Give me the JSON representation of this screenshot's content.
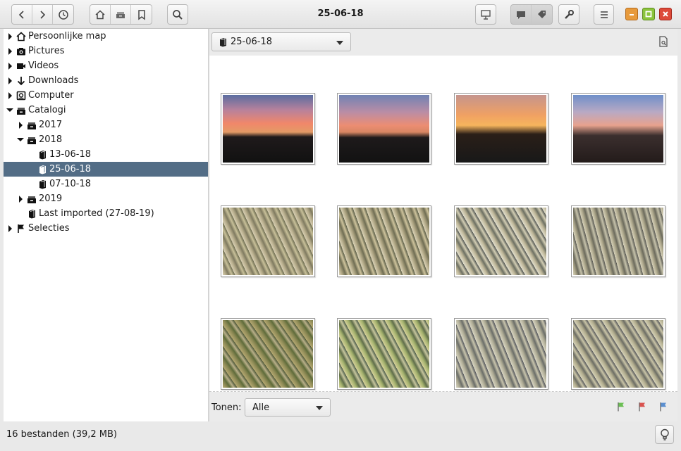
{
  "window": {
    "title": "25-06-18"
  },
  "toolbar": {
    "nav_buttons": [
      "back-icon",
      "forward-icon",
      "history-icon"
    ],
    "location_buttons": [
      "home-icon",
      "catalogs-icon",
      "bookmarks-icon"
    ],
    "search": "search-icon",
    "right_buttons": [
      "presentation-icon",
      "comment-icon",
      "tag-icon",
      "tools-icon",
      "menu-icon"
    ],
    "window_controls": {
      "minimize_color": "#e79a3c",
      "maximize_color": "#8cc43d",
      "close_color": "#dd4a3a"
    }
  },
  "sidebar": {
    "items": [
      {
        "label": "Persoonlijke map",
        "icon": "home-icon",
        "depth": 0,
        "expander": "collapsed"
      },
      {
        "label": "Pictures",
        "icon": "camera-icon",
        "depth": 0,
        "expander": "collapsed"
      },
      {
        "label": "Videos",
        "icon": "video-icon",
        "depth": 0,
        "expander": "collapsed"
      },
      {
        "label": "Downloads",
        "icon": "download-icon",
        "depth": 0,
        "expander": "collapsed"
      },
      {
        "label": "Computer",
        "icon": "harddisk-icon",
        "depth": 0,
        "expander": "collapsed"
      },
      {
        "label": "Catalogi",
        "icon": "catalog-library-icon",
        "depth": 0,
        "expander": "expanded"
      },
      {
        "label": "2017",
        "icon": "catalog-library-icon",
        "depth": 1,
        "expander": "collapsed"
      },
      {
        "label": "2018",
        "icon": "catalog-library-icon",
        "depth": 1,
        "expander": "expanded"
      },
      {
        "label": "13-06-18",
        "icon": "catalog-icon",
        "depth": 2,
        "expander": "none"
      },
      {
        "label": "25-06-18",
        "icon": "catalog-icon",
        "depth": 2,
        "expander": "none",
        "selected": true
      },
      {
        "label": "07-10-18",
        "icon": "catalog-icon",
        "depth": 2,
        "expander": "none"
      },
      {
        "label": "2019",
        "icon": "catalog-library-icon",
        "depth": 1,
        "expander": "collapsed"
      },
      {
        "label": "Last imported (27-08-19)",
        "icon": "catalog-icon",
        "depth": 1,
        "expander": "none"
      },
      {
        "label": "Selecties",
        "icon": "flag-icon",
        "depth": 0,
        "expander": "collapsed"
      }
    ],
    "selected_color": "#536d86"
  },
  "location": {
    "current": "25-06-18"
  },
  "thumbnails": [
    {
      "name": "sunset-1",
      "style": "sunset1"
    },
    {
      "name": "sunset-2",
      "style": "sunset2"
    },
    {
      "name": "sunset-3",
      "style": "sunset3"
    },
    {
      "name": "sunset-4",
      "style": "sunset4"
    },
    {
      "name": "bush-1",
      "style": "bush1"
    },
    {
      "name": "bush-2",
      "style": "bush2"
    },
    {
      "name": "bush-3",
      "style": "bush3"
    },
    {
      "name": "bush-4",
      "style": "bush4"
    },
    {
      "name": "bush-5",
      "style": "bush5"
    },
    {
      "name": "bush-6",
      "style": "bush6"
    },
    {
      "name": "bush-7",
      "style": "bush7"
    },
    {
      "name": "bush-8",
      "style": "bush8"
    }
  ],
  "filter": {
    "label": "Tonen:",
    "value": "Alle",
    "flags": [
      {
        "name": "flag-green-icon",
        "color": "#6cbf55"
      },
      {
        "name": "flag-red-icon",
        "color": "#d9534f"
      },
      {
        "name": "flag-blue-icon",
        "color": "#5b8fd0"
      }
    ]
  },
  "status": {
    "text": "16 bestanden (39,2 MB)"
  }
}
